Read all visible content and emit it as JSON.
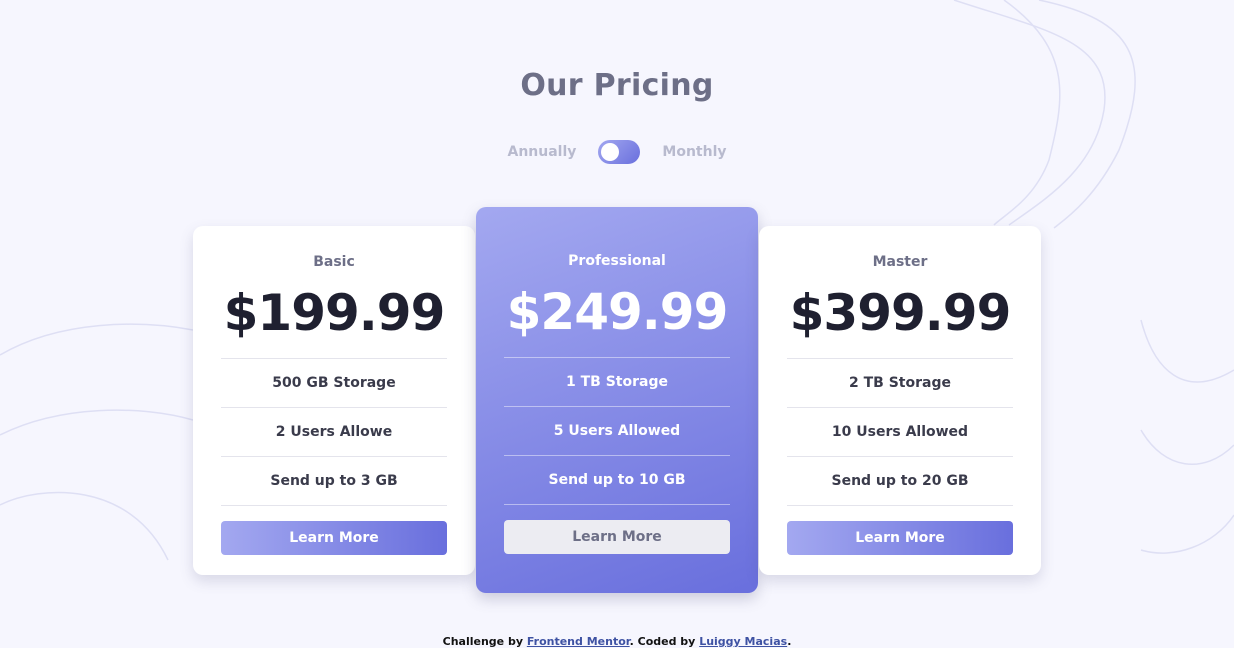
{
  "page": {
    "title": "Our Pricing"
  },
  "billing_toggle": {
    "left_label": "Annually",
    "right_label": "Monthly",
    "state": "annually"
  },
  "plans": [
    {
      "name": "Basic",
      "price": "$199.99",
      "features": [
        "500 GB Storage",
        "2 Users Allowe",
        "Send up to 3 GB"
      ],
      "button_label": "Learn More"
    },
    {
      "name": "Professional",
      "price": "$249.99",
      "features": [
        "1 TB Storage",
        "5 Users Allowed",
        "Send up to 10 GB"
      ],
      "button_label": "Learn More"
    },
    {
      "name": "Master",
      "price": "$399.99",
      "features": [
        "2 TB Storage",
        "10 Users Allowed",
        "Send up to 20 GB"
      ],
      "button_label": "Learn More"
    }
  ],
  "footer": {
    "prefix": "Challenge by ",
    "link1": "Frontend Mentor",
    "middle": ". Coded by ",
    "link2": "Luiggy Macias",
    "suffix": "."
  },
  "colors": {
    "background": "#f6f6fe",
    "accent_start": "#a3a8f0",
    "accent_end": "#696fdd",
    "heading": "#6d6f87",
    "price_dark": "#1f2030"
  }
}
